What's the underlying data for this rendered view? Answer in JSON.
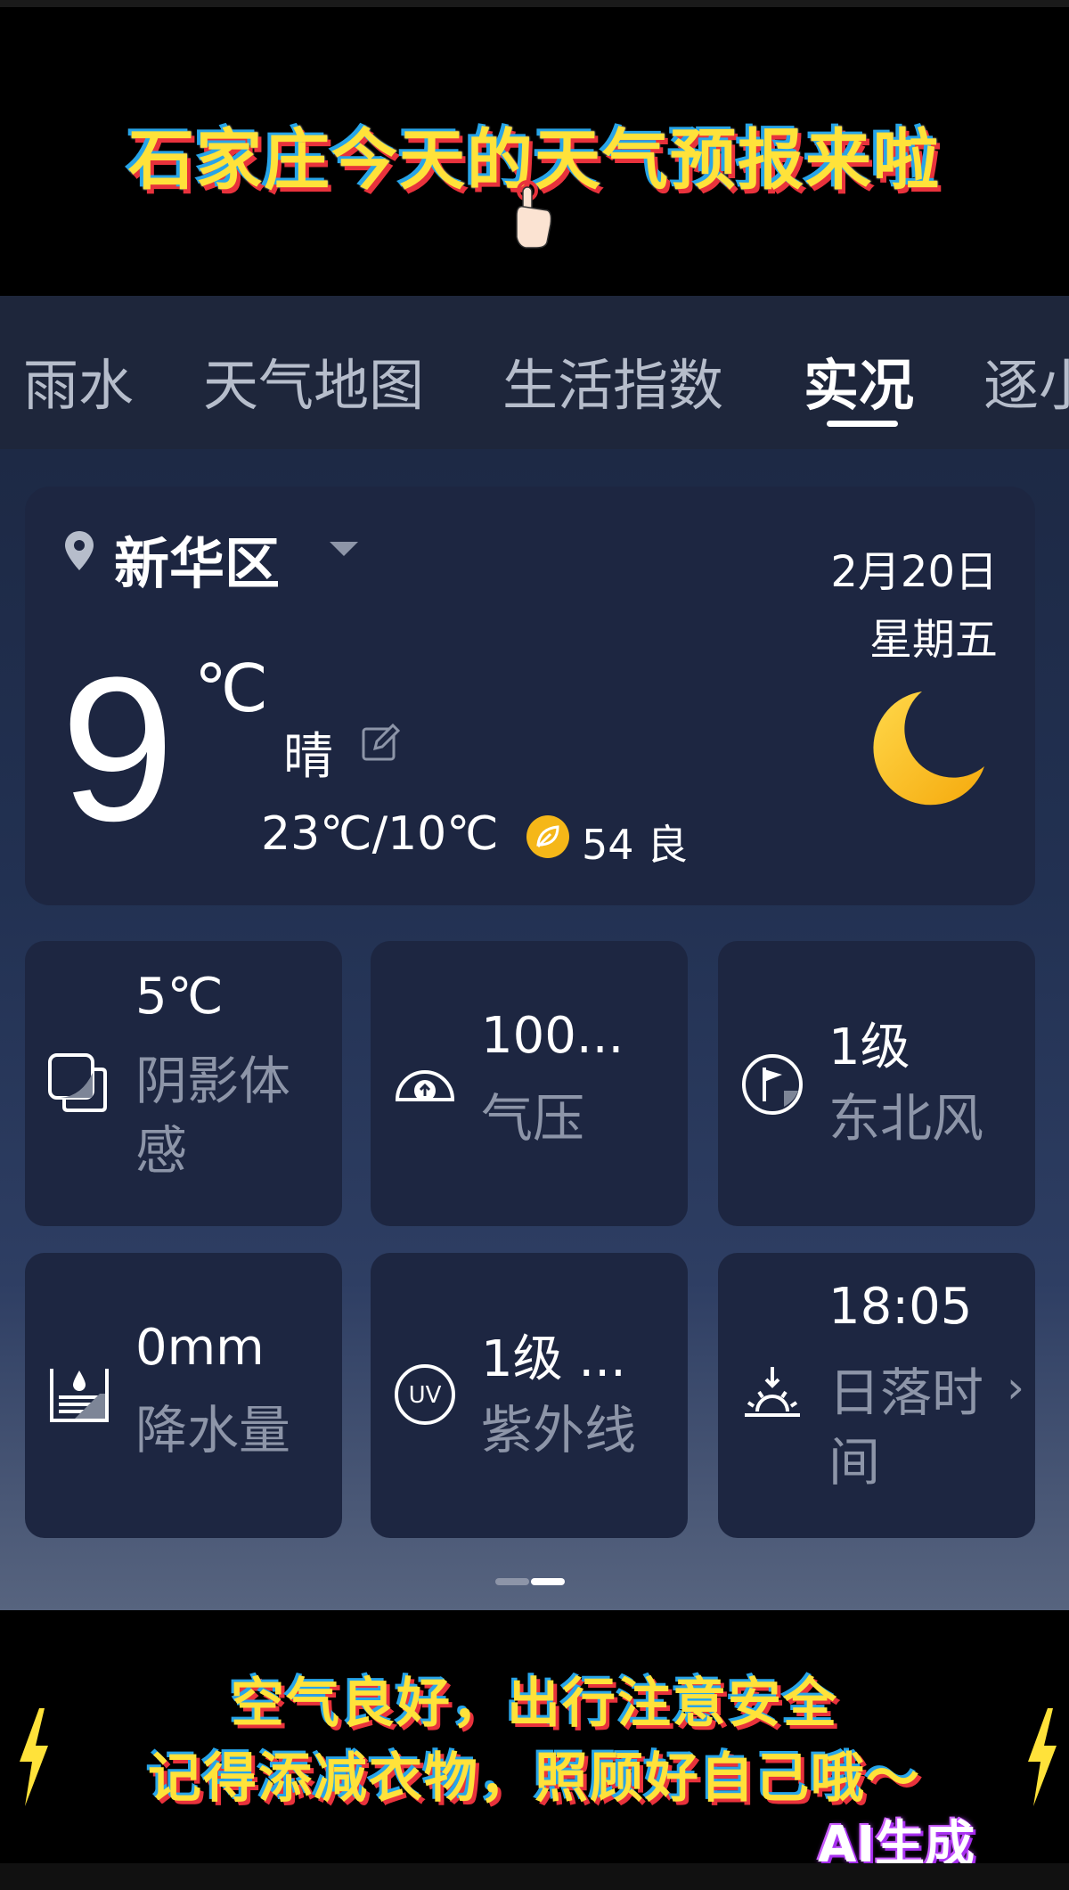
{
  "banner": {
    "title": "石家庄今天的天气预报来啦"
  },
  "tabs": [
    {
      "label": "雨水"
    },
    {
      "label": "天气地图"
    },
    {
      "label": "生活指数"
    },
    {
      "label": "实况"
    },
    {
      "label": "逐小"
    }
  ],
  "current": {
    "location": "新华区",
    "date": "2月20日",
    "weekday": "星期五",
    "temperature": "9",
    "unit": "℃",
    "condition": "晴",
    "range": "23℃/10℃",
    "aqi": "54 良",
    "weather_icon": "moon-icon"
  },
  "metrics": [
    {
      "value": "5℃",
      "label": "阴影体感",
      "icon": "feels-like-icon"
    },
    {
      "value": "100...",
      "label": "气压",
      "icon": "pressure-icon"
    },
    {
      "value": "1级",
      "label": "东北风",
      "icon": "wind-flag-icon"
    },
    {
      "value": "0mm",
      "label": "降水量",
      "icon": "precipitation-icon"
    },
    {
      "value": "1级 ...",
      "label": "紫外线",
      "icon": "uv-icon"
    },
    {
      "value": "18:05",
      "label": "日落时间",
      "icon": "sunset-icon"
    }
  ],
  "captions": {
    "line1": "空气良好，出行注意安全",
    "line2": "记得添减衣物，照顾好自己哦～",
    "ai_badge": "AI生成"
  },
  "colors": {
    "banner_text": "#ffe23a",
    "tab_bar": "#1e263b",
    "card": "#1d2641",
    "muted_label": "#8d95a8",
    "moon": "#f8c51c"
  }
}
